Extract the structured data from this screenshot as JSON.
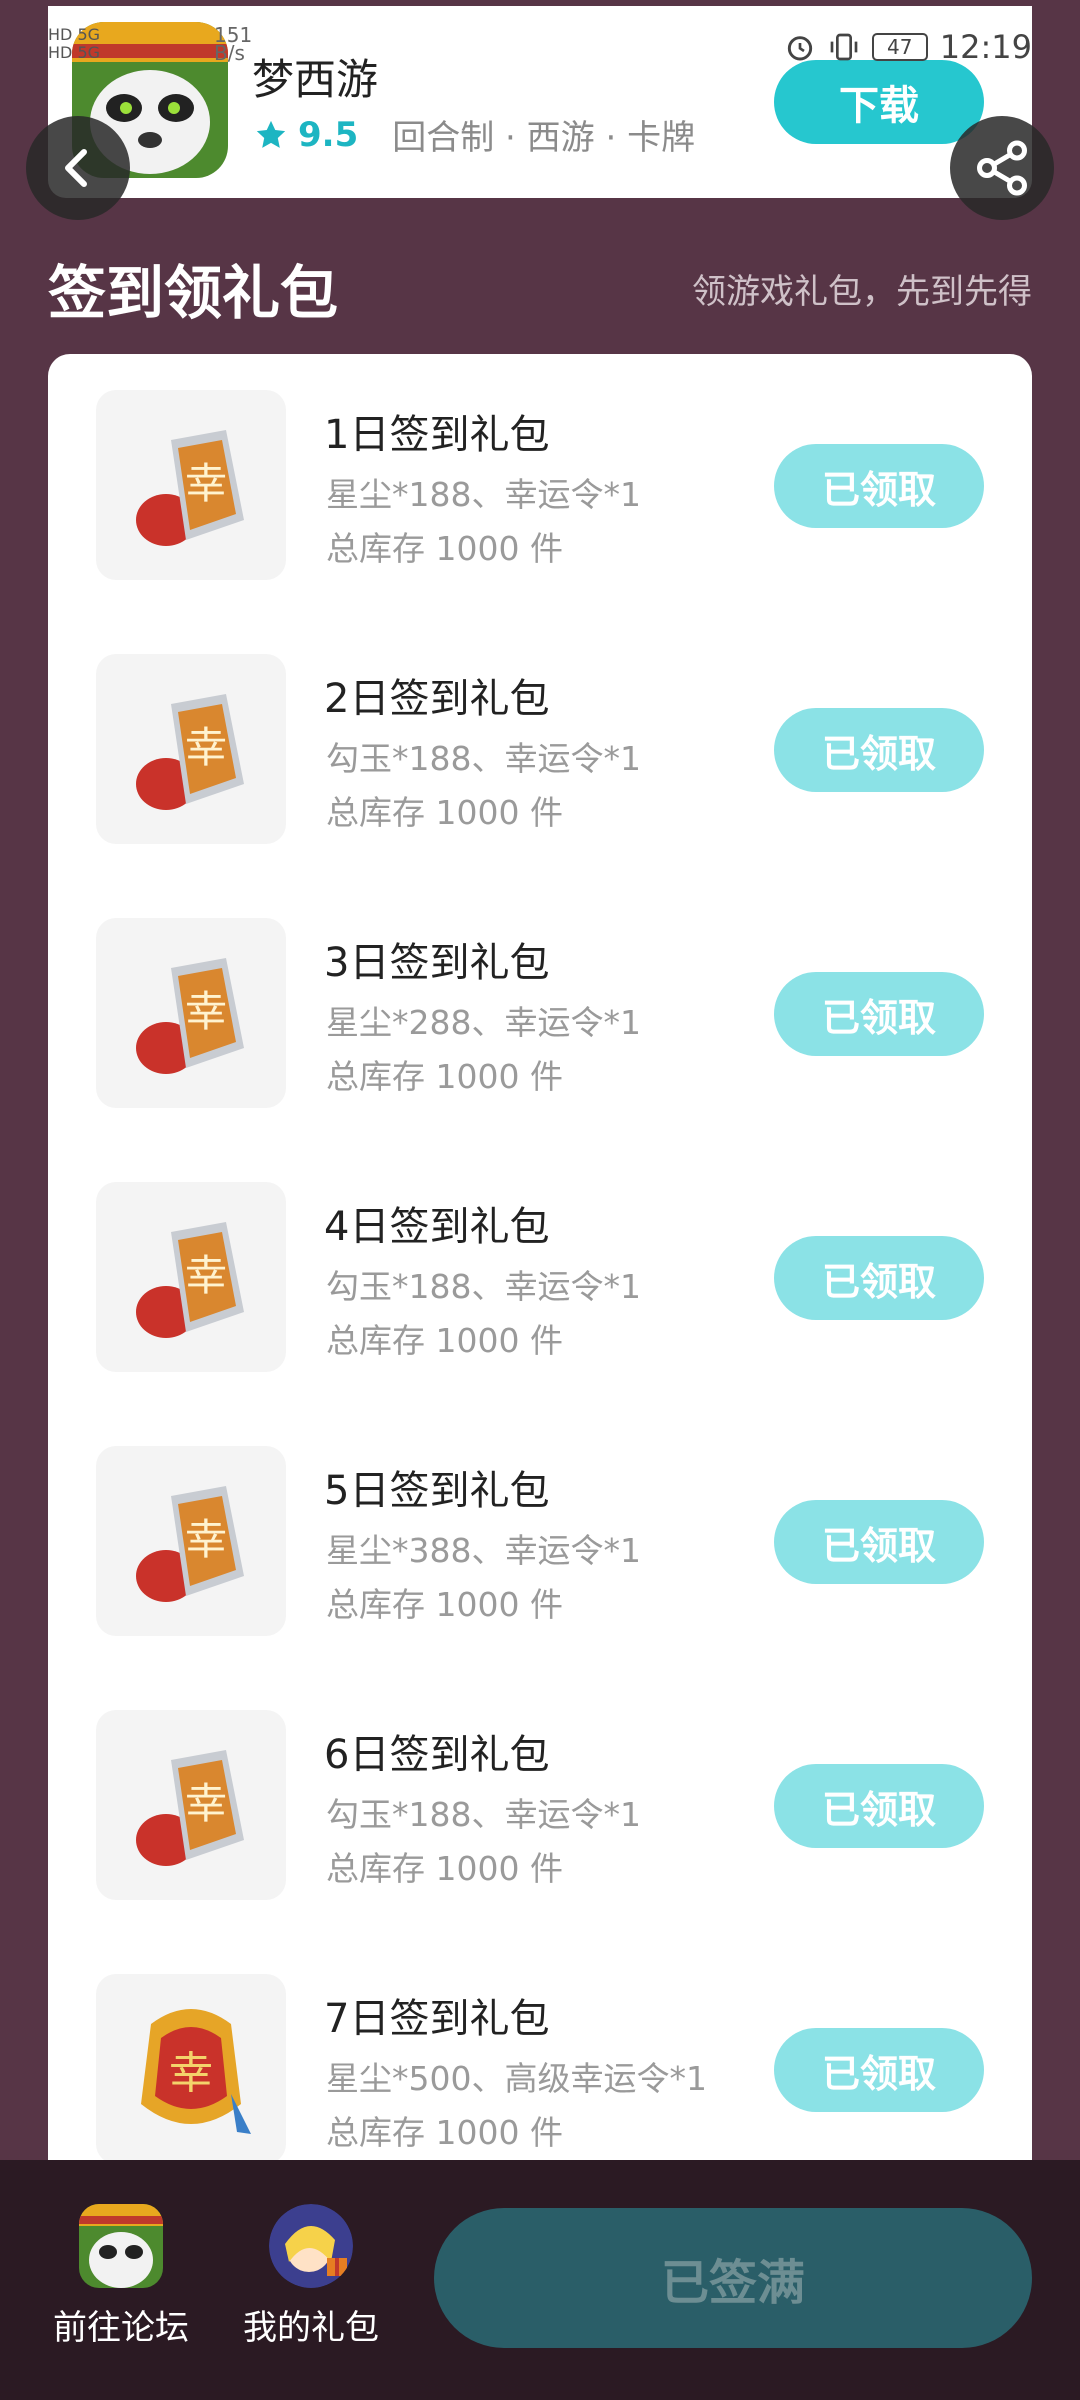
{
  "status_bar": {
    "left_top": "HD 5G",
    "left_bottom": "HD 5G",
    "net_speed": "151 B/s",
    "battery": "47",
    "time": "12:19"
  },
  "app": {
    "name": "梦西游",
    "rating": "9.5",
    "tags": "回合制 · 西游 · 卡牌",
    "download_label": "下载"
  },
  "section": {
    "title": "签到领礼包",
    "subtitle": "领游戏礼包，先到先得"
  },
  "gifts": [
    {
      "title": "1日签到礼包",
      "desc": "星尘*188、幸运令*1",
      "stock": "总库存 1000 件",
      "button": "已领取"
    },
    {
      "title": "2日签到礼包",
      "desc": "勾玉*188、幸运令*1",
      "stock": "总库存 1000 件",
      "button": "已领取"
    },
    {
      "title": "3日签到礼包",
      "desc": "星尘*288、幸运令*1",
      "stock": "总库存 1000 件",
      "button": "已领取"
    },
    {
      "title": "4日签到礼包",
      "desc": "勾玉*188、幸运令*1",
      "stock": "总库存 1000 件",
      "button": "已领取"
    },
    {
      "title": "5日签到礼包",
      "desc": "星尘*388、幸运令*1",
      "stock": "总库存 1000 件",
      "button": "已领取"
    },
    {
      "title": "6日签到礼包",
      "desc": "勾玉*188、幸运令*1",
      "stock": "总库存 1000 件",
      "button": "已领取"
    },
    {
      "title": "7日签到礼包",
      "desc": "星尘*500、高级幸运令*1",
      "stock": "总库存 1000 件",
      "button": "已领取"
    }
  ],
  "bottom": {
    "forum_label": "前往论坛",
    "my_gift_label": "我的礼包",
    "signed_label": "已签满"
  },
  "colors": {
    "background": "#573546",
    "accent": "#26c7cf",
    "claimed": "#8be2e6",
    "bottom_bar": "#2b1a23",
    "signed_button": "#2a5e68"
  }
}
